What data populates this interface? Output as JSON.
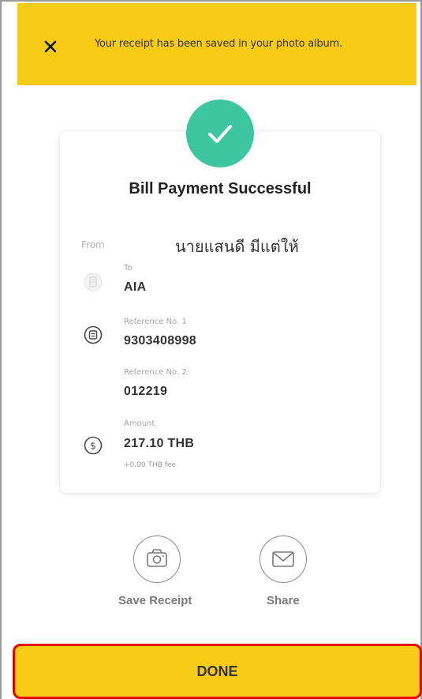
{
  "banner": {
    "message": "Your receipt has been saved in your photo album.",
    "close_icon": "close-icon",
    "color": "#f8cc16"
  },
  "receipt": {
    "success_icon": "check-icon",
    "success_color": "#3ec6a0",
    "title": "Bill Payment Successful",
    "from_label": "From",
    "from_value": "นายแสนดี มีแต่ให้",
    "to_label": "To",
    "to_value": "AIA",
    "ref1_label": "Reference No. 1",
    "ref1_value": "9303408998",
    "ref2_label": "Reference No. 2",
    "ref2_value": "012219",
    "amount_label": "Amount",
    "amount_value": "217.10 THB",
    "fee": "+0.00 THB fee"
  },
  "actions": {
    "save_label": "Save Receipt",
    "share_label": "Share"
  },
  "footer": {
    "done_label": "DONE",
    "highlight_color": "#e60000"
  }
}
